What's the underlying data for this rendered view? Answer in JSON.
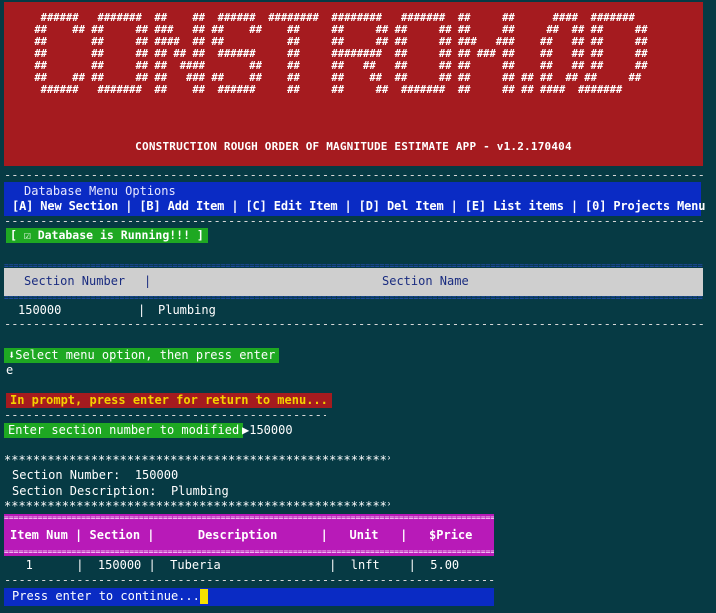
{
  "banner": {
    "art": "  ######   #######  ##    ##  ######  ########  ########   #######  ##     ##      ####  #######  \n ##    ## ##     ## ###   ## ##    ##    ##     ##     ## ##     ## ##     ##     ##  ## ##     ## \n ##       ##     ## ####  ## ##          ##     ##     ## ##     ## ###   ###    ##   ## ##     ## \n ##       ##     ## ## ## ##  ######     ##     ########  ##     ## ## ### ##    ##   ## ##     ## \n ##       ##     ## ##  ####       ##    ##     ##   ##   ##     ## ##     ##    ##   ## ##     ## \n ##    ## ##     ## ##   ### ##    ##    ##     ##    ##  ##     ## ##     ## ## ##  ## ##     ## \n  ######   #######  ##    ##  ######     ##     ##     ##  #######  ##     ## ## ####  #######  ",
    "title": "CONSTRUCTION ROUGH ORDER OF MAGNITUDE ESTIMATE APP - v1.2.170404"
  },
  "menu": {
    "title": "Database Menu Options",
    "options_line": "[A] New Section | [B] Add Item | [C] Edit Item | [D] Del Item | [E] List items | [0] Projects Menu"
  },
  "status": {
    "running": "[ ☑ Database is Running!!! ]"
  },
  "section_table": {
    "headers": [
      "Section Number",
      "|",
      "Section Name"
    ],
    "rows": [
      {
        "number": "150000",
        "sep": "|",
        "name": "Plumbing"
      }
    ]
  },
  "prompt": {
    "select_label": "Select menu option, then press enter",
    "user_input": "e",
    "return_hint": "In prompt, press enter for return to menu...",
    "section_prompt": "Enter section number to modified",
    "section_value": "150000"
  },
  "section_info": {
    "number_label": "Section Number:",
    "number_value": "150000",
    "desc_label": "Section Description:",
    "desc_value": "Plumbing"
  },
  "item_table": {
    "header_line": "Item Num | Section |      Description      |   Unit   |   $Price",
    "rows": [
      {
        "line": "   1      |  150000 |  Tuberia               |  lnft    |  5.00"
      }
    ]
  },
  "continue": {
    "label": "Press enter to continue..."
  },
  "colors": {
    "background": "#063a44",
    "banner": "#a51b1f",
    "menu": "#0a2bc4",
    "green": "#1ea822",
    "table_head": "#cfcfcf",
    "item_head": "#b81ab8",
    "cursor": "#f5e000"
  }
}
